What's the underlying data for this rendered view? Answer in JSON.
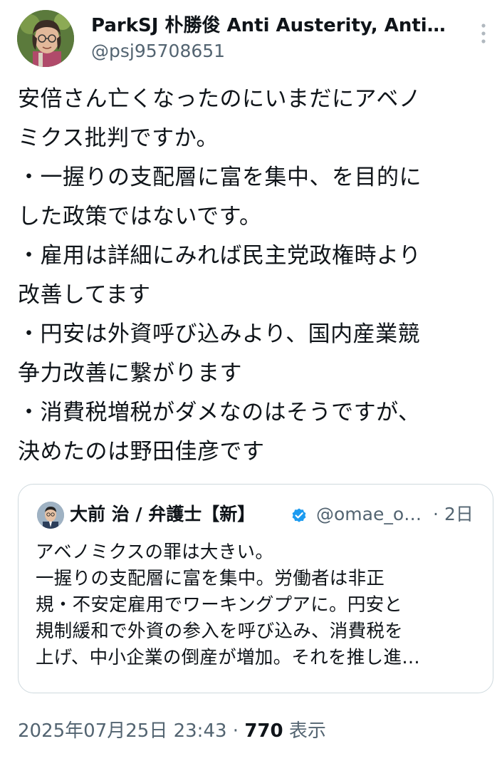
{
  "author": {
    "name": "ParkSJ 朴勝俊 Anti Austerity, Anti…",
    "handle": "@psj95708651"
  },
  "more_icon": "more-vertical-icon",
  "tweet": {
    "lines": [
      "安倍さん亡くなったのにいまだにアベノ",
      "ミクス批判ですか。",
      "・一握りの支配層に富を集中、を目的に",
      "した政策ではないです。",
      "・雇用は詳細にみれば民主党政権時より",
      "改善してます",
      "・円安は外資呼び込みより、国内産業競",
      "争力改善に繋がります",
      "・消費税増税がダメなのはそうですが、",
      "決めたのは野田佳彦です"
    ]
  },
  "quote": {
    "name": "大前 治 / 弁護士【新】",
    "verified_icon": "verified-badge-icon",
    "handle": "@omae_o…",
    "dot": "·",
    "time": "2日",
    "lines": [
      "アベノミクスの罪は大きい。",
      "一握りの支配層に富を集中。労働者は非正",
      "規・不安定雇用でワーキングプアに。円安と",
      "規制緩和で外資の参入を呼び込み、消費税を",
      "上げ、中小企業の倒産が増加。それを推し進…"
    ]
  },
  "meta": {
    "timestamp": "2025年07月25日 23:43",
    "separator": "·",
    "views_count": "770",
    "views_label": "表示"
  },
  "colors": {
    "text": "#0f1419",
    "secondary": "#536471",
    "border": "#cfd9de",
    "verified": "#1d9bf0"
  }
}
